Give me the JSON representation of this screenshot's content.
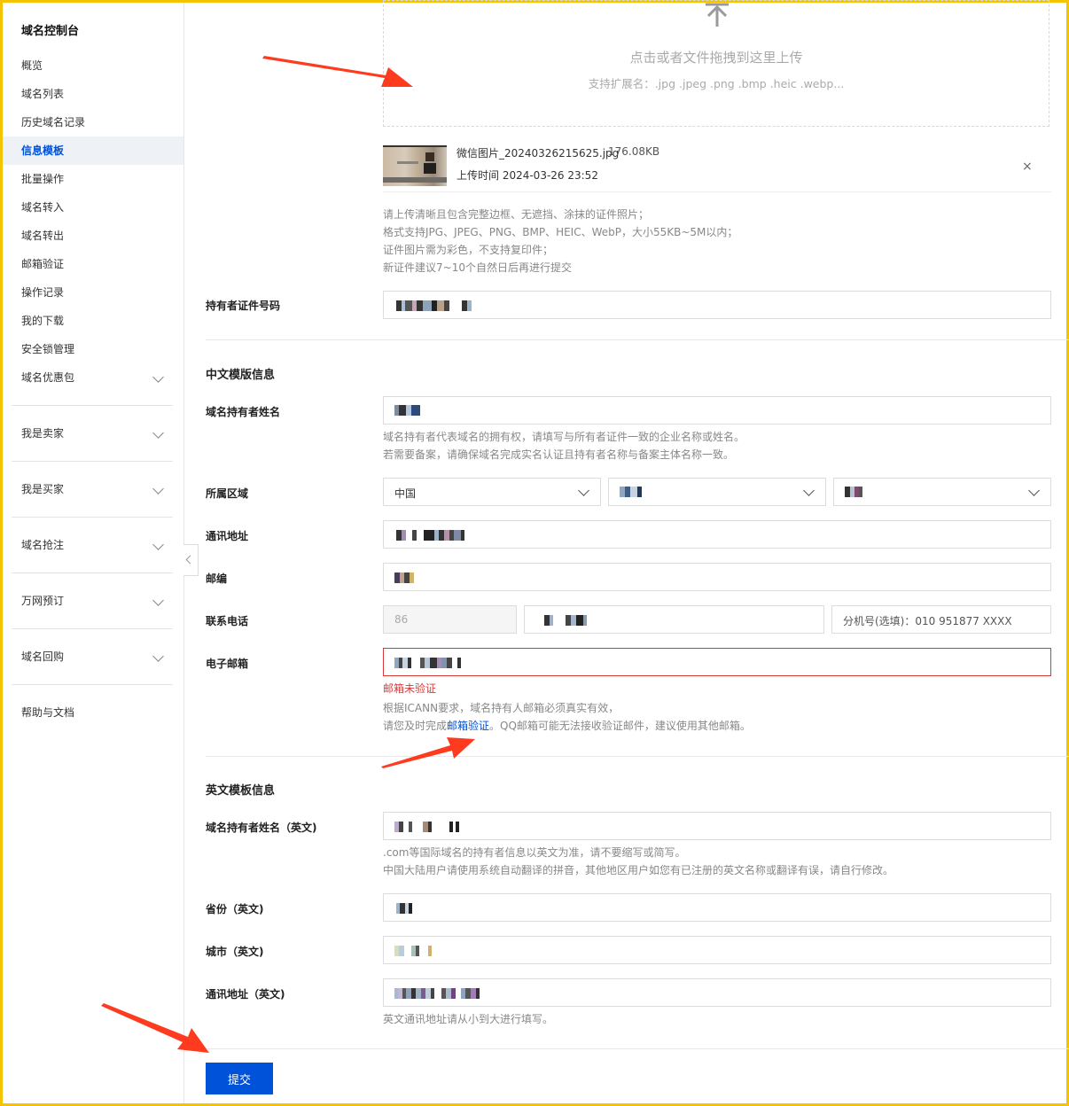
{
  "sidebar": {
    "title": "域名控制台",
    "items": [
      "概览",
      "域名列表",
      "历史域名记录",
      "信息模板",
      "批量操作",
      "域名转入",
      "域名转出",
      "邮箱验证",
      "操作记录",
      "我的下载",
      "安全锁管理",
      "域名优惠包"
    ],
    "active_item": "信息模板",
    "groups": [
      "我是卖家",
      "我是买家",
      "域名抢注",
      "万网预订",
      "域名回购"
    ],
    "help": "帮助与文档"
  },
  "upload": {
    "text": "点击或者文件拖拽到这里上传",
    "hint": "支持扩展名：.jpg .jpeg .png .bmp .heic .webp...",
    "file_name": "微信图片_20240326215625.jpg",
    "file_size": "176.08KB",
    "upload_time": "上传时间 2024-03-26 23:52",
    "close": "×",
    "rules": [
      "请上传清晰且包含完整边框、无遮挡、涂抹的证件照片；",
      "格式支持JPG、JPEG、PNG、BMP、HEIC、WebP，大小55KB~5M以内；",
      "证件图片需为彩色，不支持复印件；",
      "新证件建议7~10个自然日后再进行提交"
    ]
  },
  "id_number": {
    "label": "持有者证件号码"
  },
  "cn_section": {
    "title": "中文模版信息",
    "holder_label": "域名持有者姓名",
    "holder_hint": [
      "域名持有者代表域名的拥有权，请填写与所有者证件一致的企业名称或姓名。",
      "若需要备案，请确保域名完成实名认证且持有者名称与备案主体名称一致。"
    ],
    "region_label": "所属区域",
    "region_country": "中国",
    "address_label": "通讯地址",
    "postcode_label": "邮编",
    "phone_label": "联系电话",
    "phone_code": "86",
    "extension_placeholder": "分机号(选填)：010 951877 XXXX",
    "email_label": "电子邮箱",
    "email_error": "邮箱未验证",
    "email_hint_1": "根据ICANN要求，域名持有人邮箱必须真实有效，",
    "email_hint_2a": "请您及时完成",
    "email_hint_link": "邮箱验证",
    "email_hint_2b": "。QQ邮箱可能无法接收验证邮件，建议使用其他邮箱。"
  },
  "en_section": {
    "title": "英文模板信息",
    "holder_label": "域名持有者姓名（英文)",
    "holder_hint": [
      ".com等国际域名的持有者信息以英文为准，请不要缩写或简写。",
      "中国大陆用户请使用系统自动翻译的拼音，其他地区用户如您有已注册的英文名称或翻译有误，请自行修改。"
    ],
    "province_label": "省份（英文)",
    "city_label": "城市（英文)",
    "address_label": "通讯地址（英文)",
    "address_hint": "英文通讯地址请从小到大进行填写。"
  },
  "submit_label": "提交",
  "colors": {
    "accent": "#0052d9",
    "error": "#d63b3b",
    "annotation_arrow": "#ff3b1f",
    "frame": "#f5c400"
  }
}
